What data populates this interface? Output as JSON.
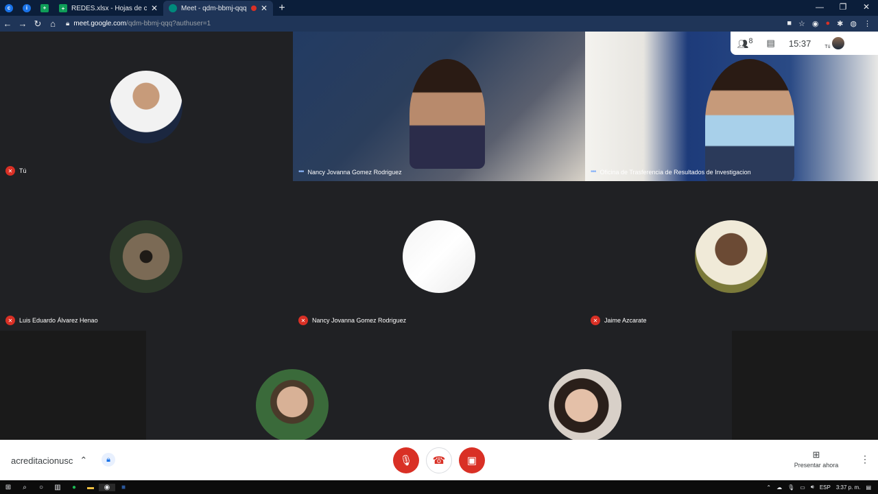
{
  "browser": {
    "tabs": [
      {
        "title": "REDES.xlsx - Hojas de cálculo de",
        "close": "✕"
      },
      {
        "title": "Meet - qdm-bbmj-qqq",
        "close": "✕"
      }
    ],
    "new_tab": "+",
    "window_controls": [
      "—",
      "❐",
      "✕"
    ],
    "url_host": "meet.google.com",
    "url_path": "/qdm-bbmj-qqq?authuser=1"
  },
  "meet": {
    "participant_count": "8",
    "clock": "15:37",
    "self_label": "Tú",
    "tiles": [
      {
        "name": "Tú",
        "muted": true
      },
      {
        "name": "Nancy Jovanna Gomez Rodriguez",
        "muted": false
      },
      {
        "name": "Oficina de Trasferencia de Resultados de Investigacion",
        "muted": false
      },
      {
        "name": "Luis Eduardo Álvarez Henao",
        "muted": true
      },
      {
        "name": "Nancy Jovanna Gomez Rodriguez",
        "muted": true
      },
      {
        "name": "Jaime Azcarate",
        "muted": true
      }
    ],
    "meeting_code": "acreditacionusc",
    "present_label": "Presentar ahora"
  },
  "taskbar": {
    "lang": "ESP",
    "time": "3:37 p. m."
  },
  "colors": {
    "danger": "#d93025",
    "meet_bg": "#202124",
    "tile_bg": "#3c4043"
  }
}
